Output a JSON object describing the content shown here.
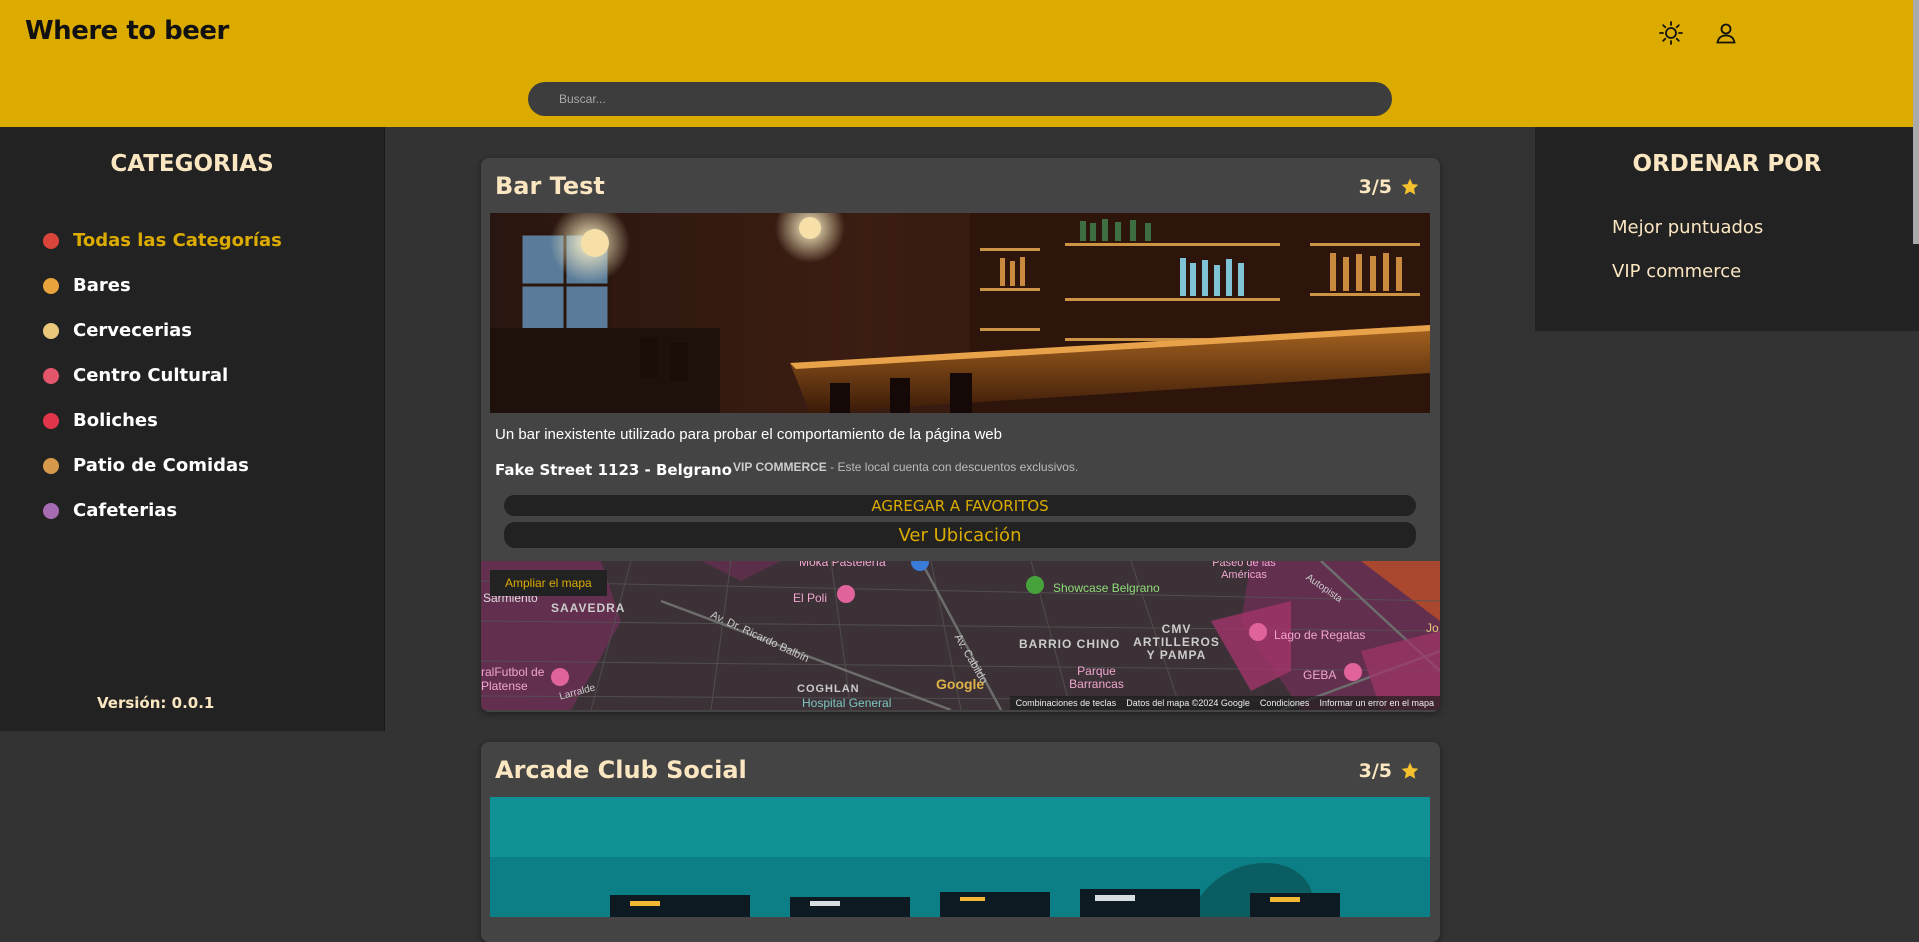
{
  "header": {
    "logo": "Where to beer",
    "search_placeholder": "Buscar..."
  },
  "categories": {
    "title": "CATEGORIAS",
    "items": [
      {
        "label": "Todas las Categorías",
        "icon": "chili-icon",
        "color": "#d9453b",
        "active": true
      },
      {
        "label": "Bares",
        "icon": "cocktail-icon",
        "color": "#e8a33c",
        "active": false
      },
      {
        "label": "Cervecerias",
        "icon": "beer-icon",
        "color": "#e9c77b",
        "active": false
      },
      {
        "label": "Centro Cultural",
        "icon": "paintbrush-icon",
        "color": "#e2556a",
        "active": false
      },
      {
        "label": "Boliches",
        "icon": "dancer-icon",
        "color": "#e0354a",
        "active": false
      },
      {
        "label": "Patio de Comidas",
        "icon": "burger-icon",
        "color": "#d79a4a",
        "active": false
      },
      {
        "label": "Cafeterias",
        "icon": "coffee-icon",
        "color": "#a76bb3",
        "active": false
      }
    ],
    "version": "Versión: 0.0.1"
  },
  "sort": {
    "title": "ORDENAR POR",
    "items": [
      "Mejor puntuados",
      "VIP commerce"
    ]
  },
  "cards": [
    {
      "title": "Bar Test",
      "rating": "3/5",
      "description": "Un bar inexistente utilizado para probar el comportamiento de la página web",
      "address": "Fake Street 1123 - Belgrano",
      "vip_label": "VIP COMMERCE",
      "vip_text": " - Este local cuenta con descuentos exclusivos.",
      "fav_button": "AGREGAR A FAVORITOS",
      "location_button": "Ver Ubicación",
      "map": {
        "expand": "Ampliar el mapa",
        "labels": {
          "moka": "Moka Pastelería",
          "poli": "El Poli",
          "showcase": "Showcase Belgrano",
          "paseo": "Paseo de las Américas",
          "saavedra": "SAAVEDRA",
          "sarmiento": "Sarmiento",
          "balbin": "Av. Dr. Ricardo Balbín",
          "cabildo": "Av. Cabildo",
          "barrio_chino": "BARRIO CHINO",
          "cmv": "CMV ARTILLEROS Y PAMPA",
          "lago": "Lago de Regatas",
          "autopista": "Autopista",
          "jo": "Jo",
          "futbol": "ralFutbol de Platense",
          "larralde": "Larralde",
          "coghlan": "COGHLAN",
          "hospital": "Hospital General",
          "parque": "Parque Barrancas",
          "geba": "GEBA",
          "google": "Google"
        },
        "footer": [
          "Combinaciones de teclas",
          "Datos del mapa ©2024 Google",
          "Condiciones",
          "Informar un error en el mapa"
        ]
      }
    },
    {
      "title": "Arcade Club Social",
      "rating": "3/5"
    }
  ],
  "colors": {
    "accent": "#dbab00",
    "panel": "#222222",
    "card": "#444444",
    "cream": "#fbe6c2"
  }
}
